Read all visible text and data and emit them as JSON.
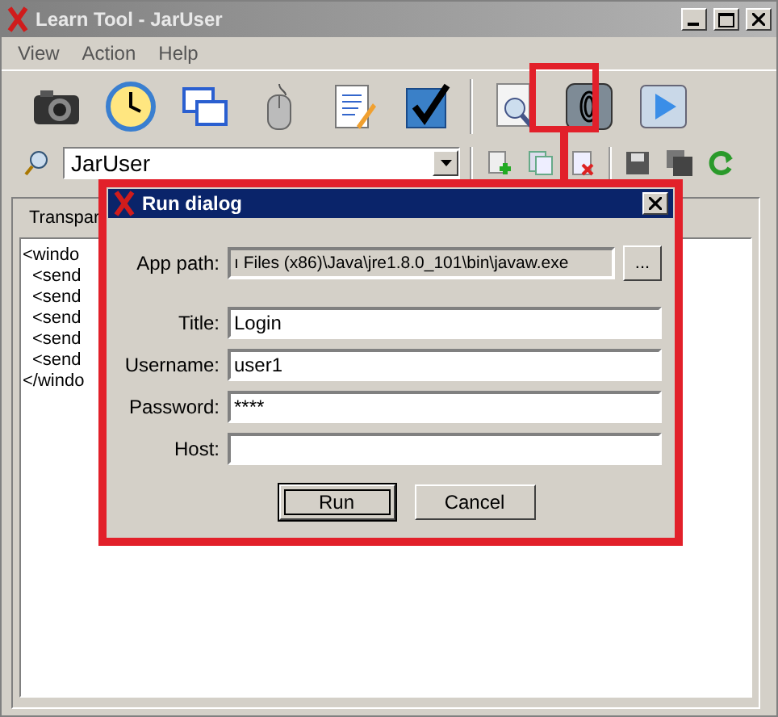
{
  "window": {
    "title": "Learn Tool - JarUser"
  },
  "menu": [
    "View",
    "Action",
    "Help"
  ],
  "selector": {
    "value": "JarUser"
  },
  "panel": {
    "label": "Transpar"
  },
  "editor": {
    "lines": [
      {
        "text": "<windo",
        "children": [
          {
            "text": "<send"
          },
          {
            "text": "<send"
          },
          {
            "text": "<send"
          },
          {
            "text": "<send"
          },
          {
            "text": "<send"
          }
        ]
      },
      {
        "text": "</windo"
      }
    ]
  },
  "dialog": {
    "title": "Run dialog",
    "fields": [
      {
        "label": "App path:",
        "value": "ı Files (x86)\\Java\\jre1.8.0_101\\bin\\javaw.exe",
        "disabled": true,
        "browse": "..."
      },
      {
        "label": "Title:",
        "value": "Login",
        "disabled": false
      },
      {
        "label": "Username:",
        "value": "user1",
        "disabled": false
      },
      {
        "label": "Password:",
        "value": "****",
        "disabled": false
      },
      {
        "label": "Host:",
        "disabled": false
      }
    ],
    "buttons": [
      {
        "label": "Run",
        "selected": true
      },
      {
        "label": "Cancel",
        "selected": false
      }
    ]
  }
}
